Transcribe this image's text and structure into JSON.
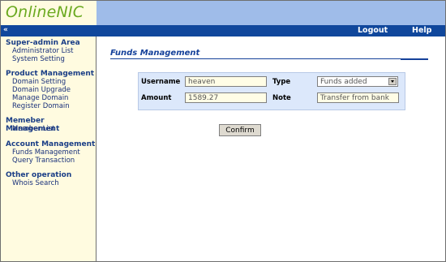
{
  "header": {
    "logo_text": "OnlineNIC"
  },
  "navbar": {
    "arrows": "«",
    "logout": "Logout",
    "help": "Help"
  },
  "sidebar": {
    "sections": [
      {
        "title": "Super-admin Area",
        "items": [
          "Administrator List",
          "System Setting"
        ]
      },
      {
        "title": "Product Management",
        "items": [
          "Domain Setting",
          "Domain Upgrade",
          "Manage Domain",
          "Register Domain"
        ]
      },
      {
        "title": "Memeber Management",
        "items": [
          "Member List"
        ]
      },
      {
        "title": "Account Management",
        "items": [
          "Funds Management",
          "Query Transaction"
        ]
      },
      {
        "title": "Other operation",
        "items": [
          "Whois Search"
        ]
      }
    ]
  },
  "main": {
    "title": "Funds Management",
    "form": {
      "username_label": "Username",
      "username_value": "heaven",
      "type_label": "Type",
      "type_value": "Funds added",
      "amount_label": "Amount",
      "amount_value": "1589.27",
      "note_label": "Note",
      "note_value": "Transfer from bank"
    },
    "confirm_label": "Confirm"
  },
  "colors": {
    "header": "#9fbce9",
    "navbar": "#10479c",
    "sidebar": "#fffbe0",
    "logo": "#6aa91f",
    "form_box": "#dce8fb"
  }
}
